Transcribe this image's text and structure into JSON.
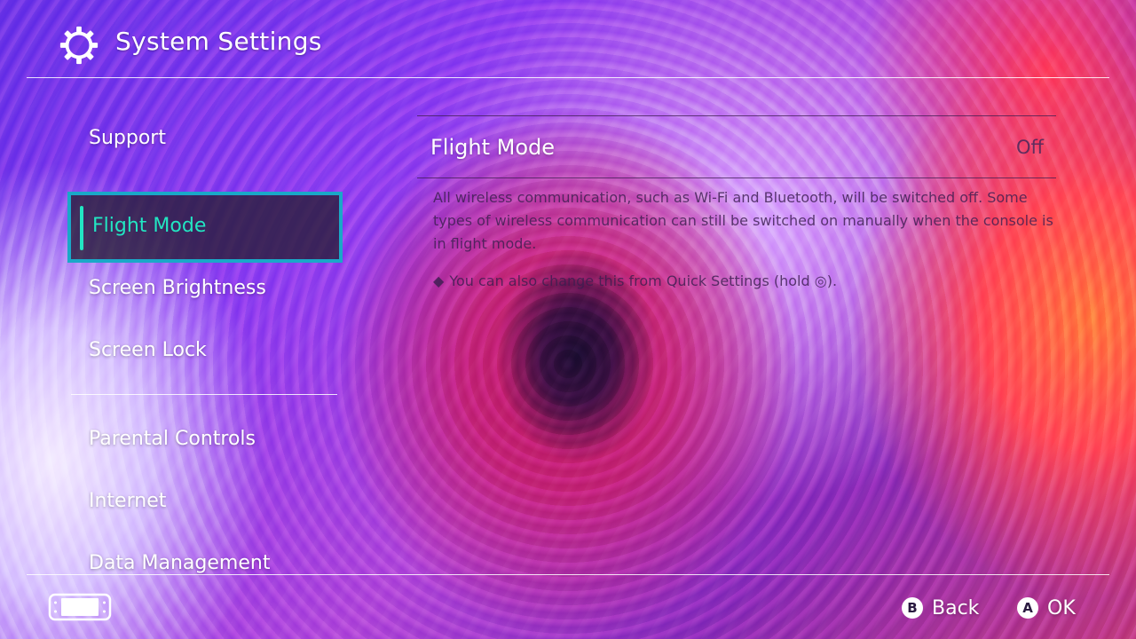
{
  "header": {
    "title": "System Settings",
    "icon": "gear-icon"
  },
  "sidebar": {
    "items": [
      {
        "label": "Support"
      },
      {
        "label": "Flight Mode",
        "selected": true
      },
      {
        "label": "Screen Brightness"
      },
      {
        "label": "Screen Lock"
      },
      {
        "label": "Parental Controls"
      },
      {
        "label": "Internet"
      },
      {
        "label": "Data Management"
      }
    ]
  },
  "detail": {
    "setting_title": "Flight Mode",
    "setting_value": "Off",
    "description": "All wireless communication, such as Wi-Fi and Bluetooth, will be switched off. Some types of wireless communication can still be switched on manually when the console is in flight mode.",
    "note_bullet": "◆",
    "note": "You can also change this from Quick Settings (hold ◎)."
  },
  "footer": {
    "console_icon": "handheld-console-icon",
    "back": {
      "button": "B",
      "label": "Back"
    },
    "ok": {
      "button": "A",
      "label": "OK"
    }
  },
  "colors": {
    "selection_border": "#1aa8c8",
    "selection_text": "#22e6c2",
    "text": "#ffffff"
  }
}
